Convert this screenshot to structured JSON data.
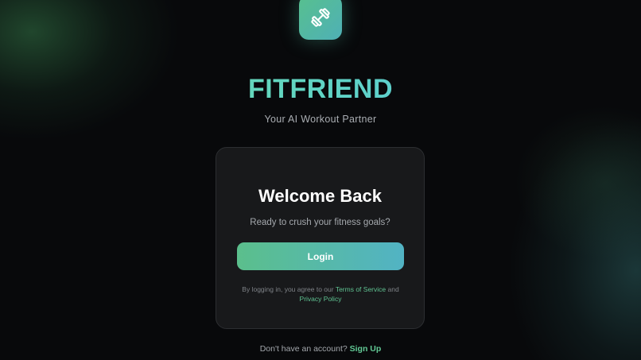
{
  "app": {
    "name": "FITFRIEND",
    "tagline": "Your AI Workout Partner",
    "logo_icon": "dumbbell-icon"
  },
  "card": {
    "title": "Welcome Back",
    "subtitle": "Ready to crush your fitness goals?",
    "login_label": "Login",
    "terms_prefix": "By logging in, you agree to our",
    "terms_link": "Terms of Service",
    "terms_and": "and",
    "privacy_link": "Privacy Policy"
  },
  "footer": {
    "signup_prompt": "Don't have an account?",
    "signup_link": "Sign Up"
  },
  "colors": {
    "background": "#08090b",
    "card": "#18191b",
    "accent_green": "#5bbf8c",
    "accent_teal": "#52b3c4"
  }
}
